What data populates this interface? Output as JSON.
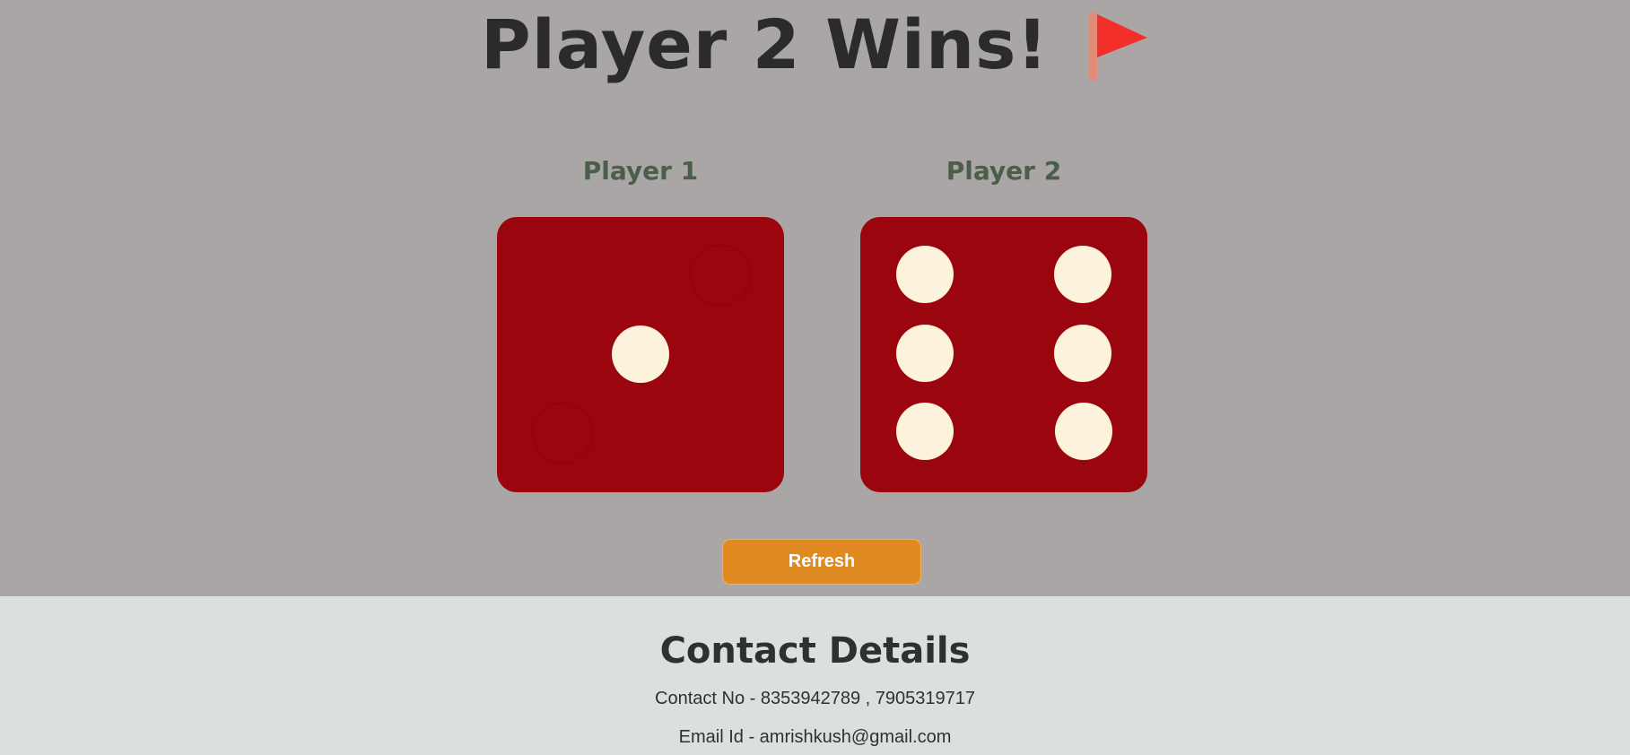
{
  "header": {
    "title": "Player 2 Wins!",
    "flag_icon": "red-flag-icon"
  },
  "players": [
    {
      "label": "Player 1",
      "die_value": 1
    },
    {
      "label": "Player 2",
      "die_value": 6
    }
  ],
  "controls": {
    "refresh_label": "Refresh"
  },
  "footer": {
    "title": "Contact Details",
    "contact_no": "Contact No - 8353942789 , 7905319717",
    "email": "Email Id - amrishkush@gmail.com"
  },
  "colors": {
    "background": "#aaa6a5",
    "die": "#9a050e",
    "pip": "#fdf2dc",
    "button": "#e08a22",
    "footer": "#dbdfde"
  }
}
